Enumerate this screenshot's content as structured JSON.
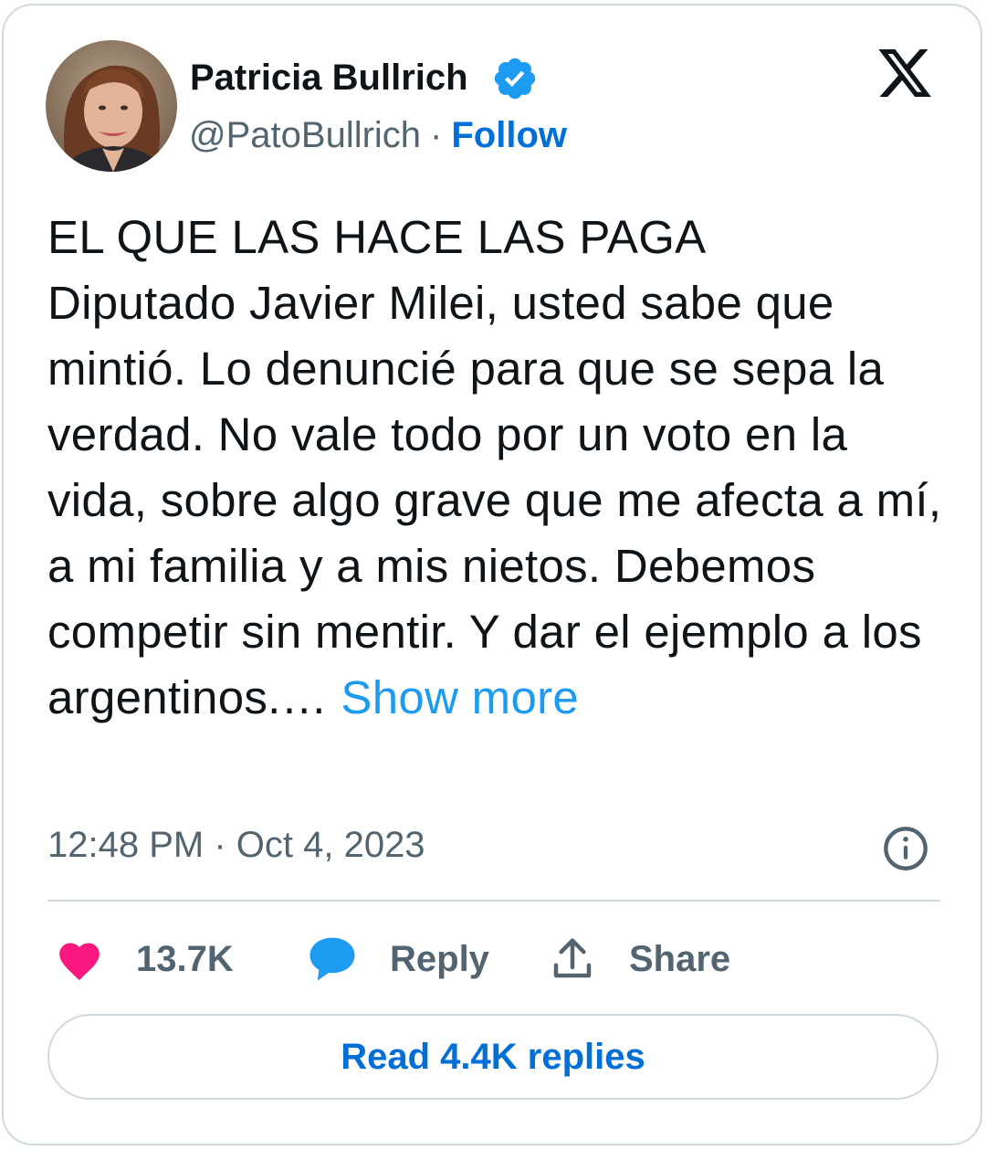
{
  "author": {
    "display_name": "Patricia Bullrich",
    "handle": "@PatoBullrich",
    "separator": "·",
    "follow_label": "Follow",
    "verified": true,
    "avatar_icon": "profile-photo-avatar"
  },
  "brand": {
    "logo_icon": "x-logo-icon"
  },
  "tweet": {
    "text": "EL QUE LAS HACE LAS PAGA\nDiputado Javier Milei, usted sabe que mintió. Lo denuncié para que se sepa la verdad. No vale todo por un voto en la vida, sobre algo grave que me afecta a mí, a mi familia y a mis nietos. Debemos competir sin mentir. Y dar el ejemplo a los argentinos.…",
    "show_more_label": "Show more",
    "timestamp": "12:48 PM · Oct 4, 2023",
    "info_icon": "info-icon"
  },
  "actions": {
    "like_count": "13.7K",
    "like_icon": "heart-icon",
    "reply_label": "Reply",
    "reply_icon": "speech-bubble-icon",
    "share_label": "Share",
    "share_icon": "share-upload-icon"
  },
  "footer": {
    "read_replies_label": "Read 4.4K replies"
  },
  "colors": {
    "text": "#0f1419",
    "secondary_text": "#536471",
    "follow_blue": "#006fd6",
    "show_more_blue": "#1d9bf0",
    "verified_blue": "#1d9bf0",
    "like_pink": "#f91880",
    "reply_blue": "#1d9bf0",
    "border": "#cfd9de"
  }
}
